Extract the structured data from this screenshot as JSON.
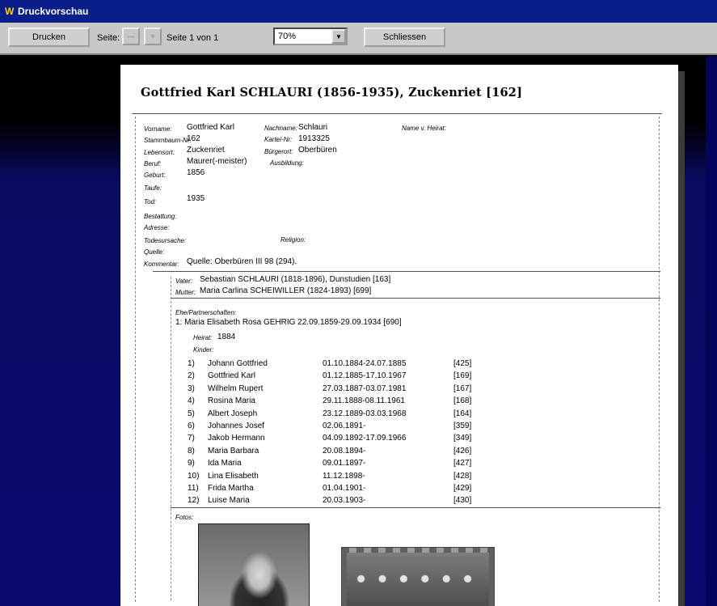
{
  "window": {
    "title": "Druckvorschau",
    "app_icon": "w-app-icon"
  },
  "toolbar": {
    "print_label": "Drucken",
    "page_label": "Seite:",
    "page_info": "Seite 1 von 1",
    "zoom_value": "70%",
    "close_label": "Schliessen"
  },
  "report": {
    "title": "Gottfried Karl SCHLAURI (1856-1935), Zuckenriet [162]",
    "fields": {
      "vorname_key": "Vorname:",
      "vorname": "Gottfried Karl",
      "nachname_key": "Nachname:",
      "nachname": "Schlauri",
      "name_vor_heirat_key": "Name v. Heirat:",
      "stammbaum_key": "Stammbaum-Nr:",
      "stammbaum": "162",
      "kartei_key": "Kartei-Nr:",
      "kartei": "1913325",
      "lebensort_key": "Lebensort:",
      "lebensort": "Zuckenriet",
      "buergerort_key": "Bürgerort:",
      "buergerort": "Oberbüren",
      "beruf_key": "Beruf:",
      "beruf": "Maurer(-meister)",
      "ausbildung_key": "Ausbildung:",
      "geburt_key": "Geburt:",
      "geburt": "1856",
      "taufe_key": "Taufe:",
      "tod_key": "Tod:",
      "tod": "1935",
      "bestattung_key": "Bestattung:",
      "adresse_key": "Adresse:",
      "todesursache_key": "Todesursache:",
      "religion_key": "Religion:",
      "quelle_key": "Quelle:",
      "kommentar_key": "Kommentar:",
      "kommentar": "Quelle: Oberbüren III 98 (294)."
    },
    "parents": {
      "vater_key": "Vater:",
      "vater": "Sebastian SCHLAURI (1818-1896), Dunstudien [163]",
      "mutter_key": "Mutter:",
      "mutter": "Maria Carlina SCHEIWILLER (1824-1893) [699]"
    },
    "partners": {
      "heading": "Ehe/Partnerschaften:",
      "partner": "1:  Maria Elisabeth Rosa GEHRIG 22.09.1859-29.09.1934 [690]",
      "heirat_key": "Heirat:",
      "heirat": "1884",
      "kinder_key": "Kinder:"
    },
    "children": [
      {
        "idx": "1)",
        "name": "Johann Gottfried",
        "dates": "01.10.1884-24.07.1885",
        "ref": "[425]"
      },
      {
        "idx": "2)",
        "name": "Gottfried Karl",
        "dates": "01.12.1885-17.10.1967",
        "ref": "[169]"
      },
      {
        "idx": "3)",
        "name": "Wilhelm Rupert",
        "dates": "27.03.1887-03.07.1981",
        "ref": "[167]"
      },
      {
        "idx": "4)",
        "name": "Rosina Maria",
        "dates": "29.11.1888-08.11.1961",
        "ref": "[168]"
      },
      {
        "idx": "5)",
        "name": "Albert Joseph",
        "dates": "23.12.1889-03.03.1968",
        "ref": "[164]"
      },
      {
        "idx": "6)",
        "name": "Johannes Josef",
        "dates": "02.06.1891-",
        "ref": "[359]"
      },
      {
        "idx": "7)",
        "name": "Jakob Hermann",
        "dates": "04.09.1892-17.09.1966",
        "ref": "[349]"
      },
      {
        "idx": "8)",
        "name": "Maria Barbara",
        "dates": "20.08.1894-",
        "ref": "[426]"
      },
      {
        "idx": "9)",
        "name": "Ida Maria",
        "dates": "09.01.1897-",
        "ref": "[427]"
      },
      {
        "idx": "10)",
        "name": "Lina Elisabeth",
        "dates": "11.12.1898-",
        "ref": "[428]"
      },
      {
        "idx": "11)",
        "name": "Frida Martha",
        "dates": "01.04.1901-",
        "ref": "[429]"
      },
      {
        "idx": "12)",
        "name": "Luise Maria",
        "dates": "20.03.1903-",
        "ref": "[430]"
      }
    ],
    "photos_key": "Fotos:"
  }
}
